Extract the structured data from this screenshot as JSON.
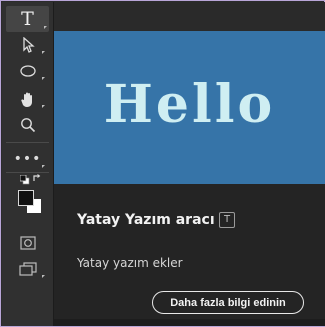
{
  "toolbar": {
    "tools": [
      {
        "name": "type-tool",
        "glyph": "T",
        "active": true
      },
      {
        "name": "path-selection-tool",
        "glyph": "arrow"
      },
      {
        "name": "ellipse-tool",
        "glyph": "ellipse"
      },
      {
        "name": "hand-tool",
        "glyph": "hand"
      },
      {
        "name": "zoom-tool",
        "glyph": "magnifier"
      },
      {
        "name": "more-tools",
        "glyph": "ellipsis"
      },
      {
        "name": "default-colors",
        "glyph": "swap"
      },
      {
        "name": "color-swatches",
        "glyph": "fg-bg",
        "foreground": "#111111",
        "background": "#ffffff"
      },
      {
        "name": "quick-mask",
        "glyph": "mask"
      },
      {
        "name": "screen-mode",
        "glyph": "screen"
      }
    ]
  },
  "canvas": {
    "text": "Hello",
    "background": "#3674a8",
    "text_color": "#cfeef2"
  },
  "tooltip": {
    "tool_name": "Yatay Yazım aracı",
    "shortcut_key": "T",
    "description": "Yatay yazım ekler",
    "learn_more_label": "Daha fazla bilgi edinin"
  }
}
